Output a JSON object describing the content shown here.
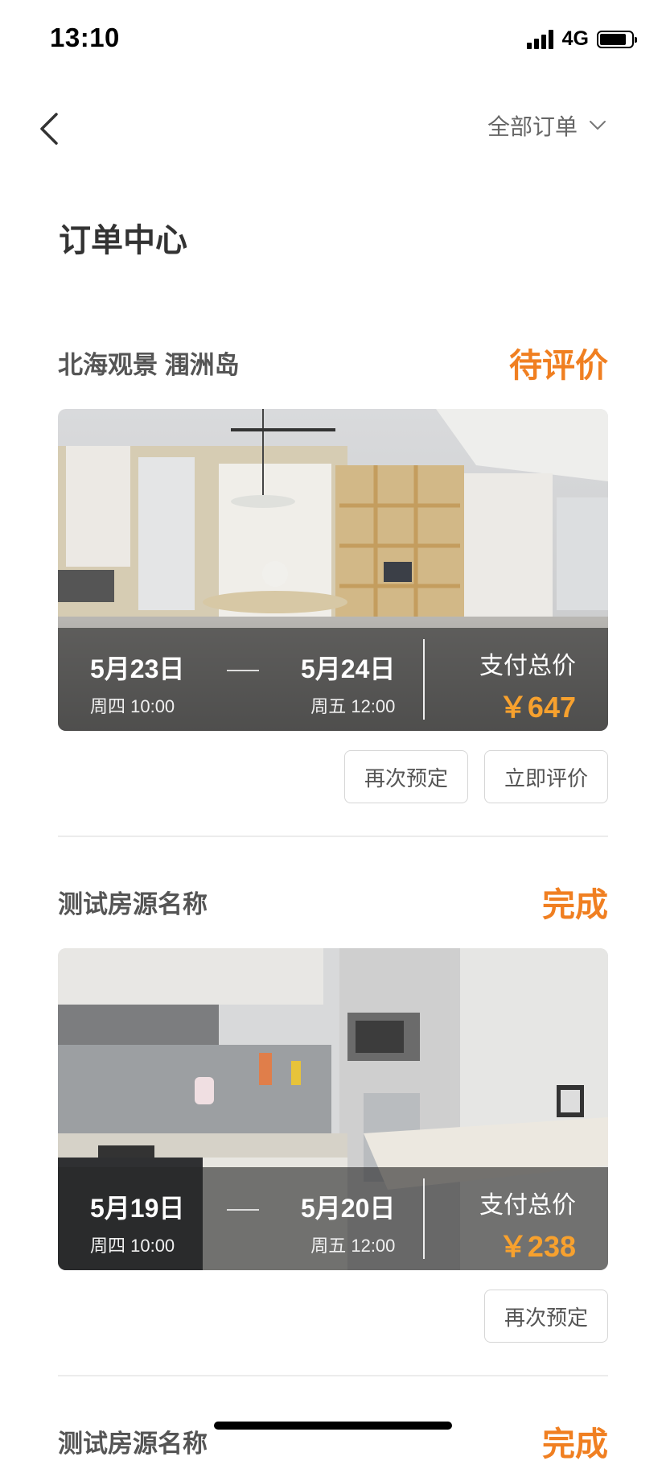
{
  "status_bar": {
    "time": "13:10",
    "network": "4G",
    "battery_level": 0.85
  },
  "nav": {
    "filter_label": "全部订单",
    "back_icon": "chevron-left-icon",
    "filter_icon": "chevron-down-icon"
  },
  "page": {
    "title": "订单中心"
  },
  "orders": [
    {
      "name": "北海观景 涠洲岛",
      "status": "待评价",
      "checkin": {
        "date": "5月23日",
        "time": "周四 10:00"
      },
      "checkout": {
        "date": "5月24日",
        "time": "周五 12:00"
      },
      "total_label": "支付总价",
      "total": "￥647",
      "actions": [
        "再次预定",
        "立即评价"
      ]
    },
    {
      "name": "测试房源名称",
      "status": "完成",
      "checkin": {
        "date": "5月19日",
        "time": "周四 10:00"
      },
      "checkout": {
        "date": "5月20日",
        "time": "周五 12:00"
      },
      "total_label": "支付总价",
      "total": "￥238",
      "actions": [
        "再次预定"
      ]
    },
    {
      "name": "测试房源名称",
      "status": "完成"
    }
  ],
  "colors": {
    "accent": "#f07f21",
    "price": "#f7a12e"
  }
}
